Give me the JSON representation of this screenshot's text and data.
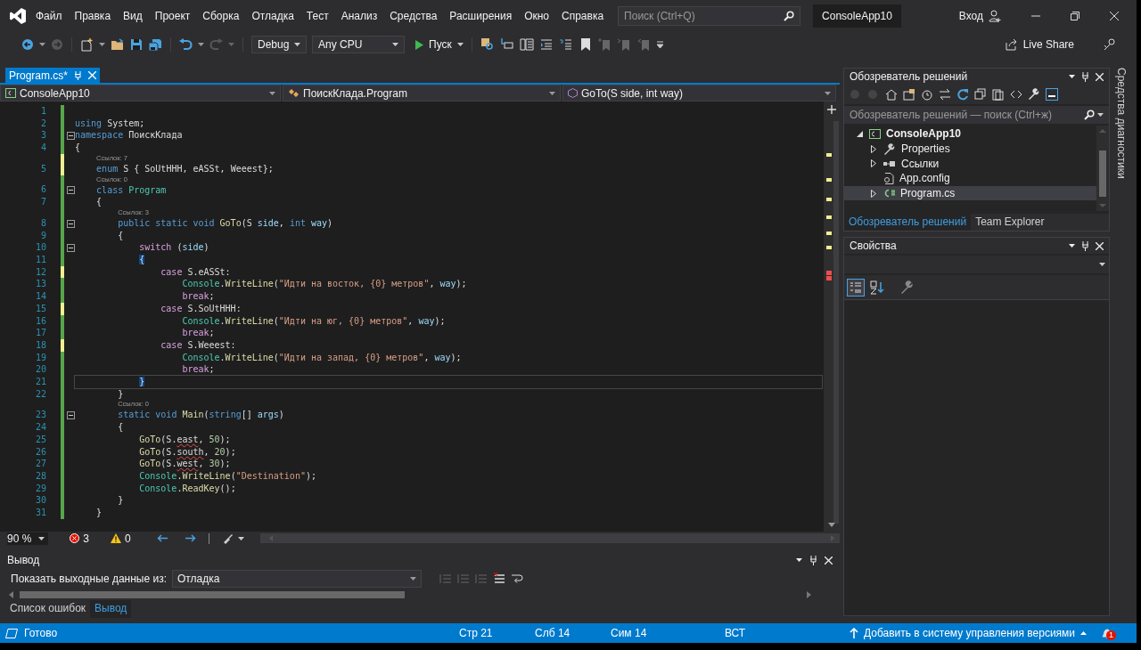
{
  "window": {
    "menu": [
      "Файл",
      "Правка",
      "Вид",
      "Проект",
      "Сборка",
      "Отладка",
      "Тест",
      "Анализ",
      "Средства",
      "Расширения",
      "Окно",
      "Справка"
    ],
    "search_placeholder": "Поиск (Ctrl+Q)",
    "project": "ConsoleApp10",
    "sign_in": "Вход"
  },
  "toolbar": {
    "configuration": "Debug",
    "platform": "Any CPU",
    "start": "Пуск",
    "live_share": "Live Share"
  },
  "editor": {
    "tabs": [
      {
        "label": "Program.cs*",
        "selected": true
      }
    ],
    "nav": [
      "ConsoleApp10",
      "ПоискКлада.Program",
      "GoTo(S side, int way)"
    ],
    "lines": [
      {
        "number": "1",
        "unsaved": false,
        "foldable": false,
        "current": false
      },
      {
        "number": "2",
        "unsaved": false,
        "foldable": false,
        "current": false,
        "tokens": [
          {
            "kind": "kw",
            "text": "using"
          },
          {
            "kind": "plain",
            "text": " System;"
          }
        ]
      },
      {
        "number": "3",
        "unsaved": false,
        "foldable": true,
        "current": false,
        "tokens": [
          {
            "kind": "kw",
            "text": "namespace"
          },
          {
            "kind": "plain",
            "text": " ПоискКлада"
          }
        ]
      },
      {
        "number": "4",
        "unsaved": false,
        "foldable": false,
        "current": false,
        "tokens": [
          {
            "kind": "plain",
            "text": "{"
          }
        ]
      },
      {
        "number": "5",
        "unsaved": true,
        "foldable": false,
        "current": false,
        "codelens": "Ссылок: 7",
        "tokens": [
          {
            "kind": "kw",
            "text": "    enum"
          },
          {
            "kind": "plain",
            "text": " S { SoUtHHH, eASSt, Weeest};"
          }
        ]
      },
      {
        "number": "6",
        "unsaved": false,
        "foldable": true,
        "current": false,
        "codelens": "Ссылок: 0",
        "tokens": [
          {
            "kind": "kw",
            "text": "    class"
          },
          {
            "kind": "type",
            "text": " Program"
          }
        ]
      },
      {
        "number": "7",
        "unsaved": false,
        "foldable": false,
        "current": false,
        "tokens": [
          {
            "kind": "plain",
            "text": "    {"
          }
        ]
      },
      {
        "number": "8",
        "unsaved": false,
        "foldable": true,
        "current": false,
        "codelens": "Ссылок: 3",
        "tokens": [
          {
            "kind": "kw",
            "text": "        public static void"
          },
          {
            "kind": "method",
            "text": " GoTo"
          },
          {
            "kind": "plain",
            "text": "(S "
          },
          {
            "kind": "param",
            "text": "side"
          },
          {
            "kind": "plain",
            "text": ", "
          },
          {
            "kind": "kw",
            "text": "int"
          },
          {
            "kind": "param",
            "text": " way"
          },
          {
            "kind": "plain",
            "text": ")"
          }
        ]
      },
      {
        "number": "9",
        "unsaved": false,
        "foldable": false,
        "current": false,
        "tokens": [
          {
            "kind": "plain",
            "text": "        {"
          }
        ]
      },
      {
        "number": "10",
        "unsaved": false,
        "foldable": true,
        "current": false,
        "tokens": [
          {
            "kind": "ctl",
            "text": "            switch"
          },
          {
            "kind": "plain",
            "text": " ("
          },
          {
            "kind": "param",
            "text": "side"
          },
          {
            "kind": "plain",
            "text": ")"
          }
        ]
      },
      {
        "number": "11",
        "unsaved": false,
        "foldable": false,
        "current": false,
        "tokens": [
          {
            "kind": "brace",
            "text": "            {"
          }
        ]
      },
      {
        "number": "12",
        "unsaved": true,
        "foldable": false,
        "current": false,
        "tokens": [
          {
            "kind": "ctl",
            "text": "                case"
          },
          {
            "kind": "plain",
            "text": " S.eASSt:"
          }
        ]
      },
      {
        "number": "13",
        "unsaved": false,
        "foldable": false,
        "current": false,
        "tokens": [
          {
            "kind": "type",
            "text": "                    Console"
          },
          {
            "kind": "plain",
            "text": "."
          },
          {
            "kind": "method",
            "text": "WriteLine"
          },
          {
            "kind": "plain",
            "text": "("
          },
          {
            "kind": "str",
            "text": "\"Идти на восток, {0} метров\""
          },
          {
            "kind": "plain",
            "text": ", "
          },
          {
            "kind": "param",
            "text": "way"
          },
          {
            "kind": "plain",
            "text": ");"
          }
        ]
      },
      {
        "number": "14",
        "unsaved": false,
        "foldable": false,
        "current": false,
        "tokens": [
          {
            "kind": "ctl",
            "text": "                    break"
          },
          {
            "kind": "plain",
            "text": ";"
          }
        ]
      },
      {
        "number": "15",
        "unsaved": true,
        "foldable": false,
        "current": false,
        "tokens": [
          {
            "kind": "ctl",
            "text": "                case"
          },
          {
            "kind": "plain",
            "text": " S.SoUtHHH:"
          }
        ]
      },
      {
        "number": "16",
        "unsaved": false,
        "foldable": false,
        "current": false,
        "tokens": [
          {
            "kind": "type",
            "text": "                    Console"
          },
          {
            "kind": "plain",
            "text": "."
          },
          {
            "kind": "method",
            "text": "WriteLine"
          },
          {
            "kind": "plain",
            "text": "("
          },
          {
            "kind": "str",
            "text": "\"Идти на юг, {0} метров\""
          },
          {
            "kind": "plain",
            "text": ", "
          },
          {
            "kind": "param",
            "text": "way"
          },
          {
            "kind": "plain",
            "text": ");"
          }
        ]
      },
      {
        "number": "17",
        "unsaved": false,
        "foldable": false,
        "current": false,
        "tokens": [
          {
            "kind": "ctl",
            "text": "                    break"
          },
          {
            "kind": "plain",
            "text": ";"
          }
        ]
      },
      {
        "number": "18",
        "unsaved": true,
        "foldable": false,
        "current": false,
        "tokens": [
          {
            "kind": "ctl",
            "text": "                case"
          },
          {
            "kind": "plain",
            "text": " S.Weeest:"
          }
        ]
      },
      {
        "number": "19",
        "unsaved": false,
        "foldable": false,
        "current": false,
        "tokens": [
          {
            "kind": "type",
            "text": "                    Console"
          },
          {
            "kind": "plain",
            "text": "."
          },
          {
            "kind": "method",
            "text": "WriteLine"
          },
          {
            "kind": "plain",
            "text": "("
          },
          {
            "kind": "str",
            "text": "\"Идти на запад, {0} метров\""
          },
          {
            "kind": "plain",
            "text": ", "
          },
          {
            "kind": "param",
            "text": "way"
          },
          {
            "kind": "plain",
            "text": ");"
          }
        ]
      },
      {
        "number": "20",
        "unsaved": false,
        "foldable": false,
        "current": false,
        "tokens": [
          {
            "kind": "ctl",
            "text": "                    break"
          },
          {
            "kind": "plain",
            "text": ";"
          }
        ]
      },
      {
        "number": "21",
        "unsaved": false,
        "foldable": false,
        "current": true,
        "tokens": [
          {
            "kind": "brace",
            "text": "            }"
          }
        ]
      },
      {
        "number": "22",
        "unsaved": false,
        "foldable": false,
        "current": false,
        "tokens": [
          {
            "kind": "plain",
            "text": "        }"
          }
        ]
      },
      {
        "number": "23",
        "unsaved": false,
        "foldable": true,
        "current": false,
        "codelens": "Ссылок: 0",
        "tokens": [
          {
            "kind": "kw",
            "text": "        static void"
          },
          {
            "kind": "method",
            "text": " Main"
          },
          {
            "kind": "plain",
            "text": "("
          },
          {
            "kind": "kw",
            "text": "string"
          },
          {
            "kind": "plain",
            "text": "[] "
          },
          {
            "kind": "param",
            "text": "args"
          },
          {
            "kind": "plain",
            "text": ")"
          }
        ]
      },
      {
        "number": "24",
        "unsaved": false,
        "foldable": false,
        "current": false,
        "tokens": [
          {
            "kind": "plain",
            "text": "        {"
          }
        ]
      },
      {
        "number": "25",
        "unsaved": false,
        "foldable": false,
        "current": false,
        "tokens": [
          {
            "kind": "method",
            "text": "            GoTo"
          },
          {
            "kind": "plain",
            "text": "(S."
          },
          {
            "kind": "error",
            "text": "east"
          },
          {
            "kind": "plain",
            "text": ", "
          },
          {
            "kind": "num",
            "text": "50"
          },
          {
            "kind": "plain",
            "text": ");"
          }
        ]
      },
      {
        "number": "26",
        "unsaved": false,
        "foldable": false,
        "current": false,
        "tokens": [
          {
            "kind": "method",
            "text": "            GoTo"
          },
          {
            "kind": "plain",
            "text": "(S."
          },
          {
            "kind": "error",
            "text": "south"
          },
          {
            "kind": "plain",
            "text": ", "
          },
          {
            "kind": "num",
            "text": "20"
          },
          {
            "kind": "plain",
            "text": ");"
          }
        ]
      },
      {
        "number": "27",
        "unsaved": false,
        "foldable": false,
        "current": false,
        "tokens": [
          {
            "kind": "method",
            "text": "            GoTo"
          },
          {
            "kind": "plain",
            "text": "(S."
          },
          {
            "kind": "error",
            "text": "west"
          },
          {
            "kind": "plain",
            "text": ", "
          },
          {
            "kind": "num",
            "text": "30"
          },
          {
            "kind": "plain",
            "text": ");"
          }
        ]
      },
      {
        "number": "28",
        "unsaved": false,
        "foldable": false,
        "current": false,
        "tokens": [
          {
            "kind": "type",
            "text": "            Console"
          },
          {
            "kind": "plain",
            "text": "."
          },
          {
            "kind": "method",
            "text": "WriteLine"
          },
          {
            "kind": "plain",
            "text": "("
          },
          {
            "kind": "str",
            "text": "\"Destination\""
          },
          {
            "kind": "plain",
            "text": ");"
          }
        ]
      },
      {
        "number": "29",
        "unsaved": false,
        "foldable": false,
        "current": false,
        "tokens": [
          {
            "kind": "type",
            "text": "            Console"
          },
          {
            "kind": "plain",
            "text": "."
          },
          {
            "kind": "method",
            "text": "ReadKey"
          },
          {
            "kind": "plain",
            "text": "();"
          }
        ]
      },
      {
        "number": "30",
        "unsaved": false,
        "foldable": false,
        "current": false,
        "tokens": [
          {
            "kind": "plain",
            "text": "        }"
          }
        ]
      },
      {
        "number": "31",
        "unsaved": false,
        "foldable": false,
        "current": false,
        "tokens": [
          {
            "kind": "plain",
            "text": "    }"
          }
        ]
      }
    ],
    "zoom": "90 %",
    "errors": "3",
    "warnings": "0"
  },
  "output": {
    "title": "Вывод",
    "source_label": "Показать выходные данные из:",
    "source": "Отладка",
    "tabs": [
      {
        "label": "Список ошибок",
        "selected": false
      },
      {
        "label": "Вывод",
        "selected": true
      }
    ]
  },
  "solution_explorer": {
    "title": "Обозреватель решений",
    "search_placeholder": "Обозреватель решений — поиск (Ctrl+ж)",
    "tree": [
      {
        "label": "ConsoleApp10",
        "kind": "project",
        "expanded": true,
        "selected": false,
        "children": [
          {
            "label": "Properties",
            "kind": "properties",
            "expanded": false,
            "selected": false
          },
          {
            "label": "Ссылки",
            "kind": "references",
            "expanded": false,
            "selected": false
          },
          {
            "label": "App.config",
            "kind": "config",
            "selected": false
          },
          {
            "label": "Program.cs",
            "kind": "csharp",
            "expanded": false,
            "selected": true
          }
        ]
      }
    ],
    "tabs": [
      {
        "label": "Обозреватель решений",
        "selected": true
      },
      {
        "label": "Team Explorer",
        "selected": false
      }
    ]
  },
  "properties": {
    "title": "Свойства"
  },
  "diagnostics_tab": "Средства диагностики",
  "status_bar": {
    "state": "Готово",
    "line": "Стр 21",
    "column": "Слб 14",
    "char": "Сим 14",
    "mode": "ВСТ",
    "source_control": "Добавить в систему управления версиями",
    "notifications": "1"
  }
}
